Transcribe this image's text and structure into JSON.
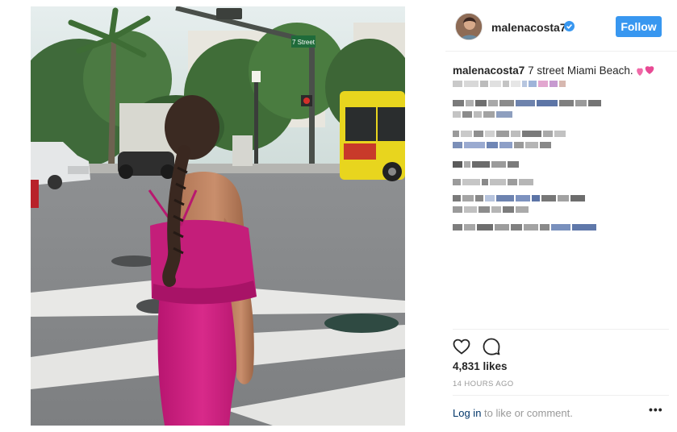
{
  "post": {
    "photo_alt": "",
    "colors": {
      "dress": "#cc1f7e",
      "sky": "#d9e6e4",
      "street": "#8f9193",
      "bus": "#e8d51e"
    },
    "street_sign": "7 Street"
  },
  "header": {
    "username": "malenacosta7",
    "verified_icon": "verified-badge-icon",
    "follow_label": "Follow"
  },
  "caption": {
    "username": "malenacosta7",
    "text": "7 street Miami Beach.",
    "emoji_icon": "two-hearts-emoji-icon"
  },
  "actions": {
    "like_icon": "heart-icon",
    "comment_icon": "comment-bubble-icon"
  },
  "likes": "4,831 likes",
  "timestamp": "14 HOURS AGO",
  "footer": {
    "login_label": "Log in",
    "rest_label": "to like or comment.",
    "more_icon": "more-dots-icon"
  },
  "accent": "#3897f0"
}
